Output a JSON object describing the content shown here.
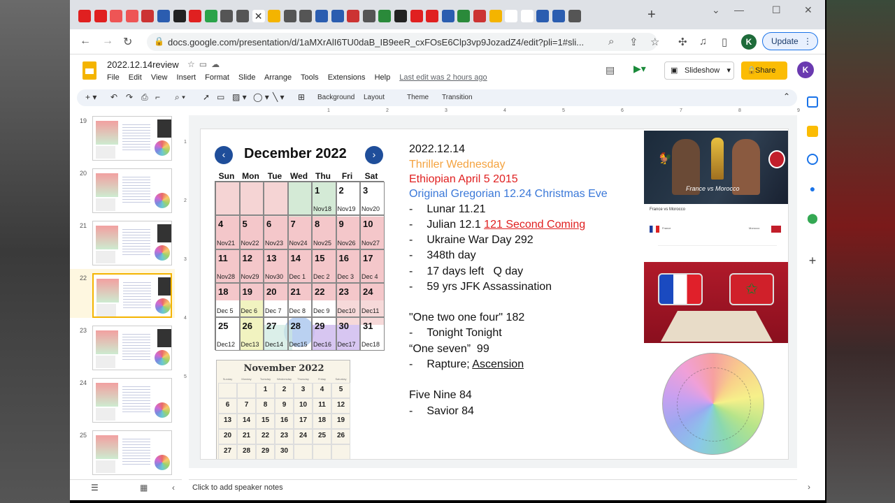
{
  "browser": {
    "url": "docs.google.com/presentation/d/1aMXrAlI6TU0daB_IB9eeR_cxFOsE6Clp3vp9JozadZ4/edit?pli=1#sli...",
    "update_label": "Update",
    "profile_initial": "K"
  },
  "doc": {
    "title": "2022.12.14review",
    "menus": [
      "File",
      "Edit",
      "View",
      "Insert",
      "Format",
      "Slide",
      "Arrange",
      "Tools",
      "Extensions",
      "Help"
    ],
    "last_edit": "Last edit was 2 hours ago",
    "slideshow_label": "Slideshow",
    "share_label": "Share",
    "user_initial": "K"
  },
  "toolbar": {
    "background": "Background",
    "layout": "Layout",
    "theme": "Theme",
    "transition": "Transition"
  },
  "ruler_marks": [
    "1",
    "2",
    "3",
    "4",
    "5",
    "6",
    "7",
    "8",
    "9"
  ],
  "vruler_marks": [
    "1",
    "2",
    "3",
    "4",
    "5"
  ],
  "thumbnails": [
    {
      "num": "19"
    },
    {
      "num": "20"
    },
    {
      "num": "21"
    },
    {
      "num": "22"
    },
    {
      "num": "23"
    },
    {
      "num": "24"
    },
    {
      "num": "25"
    }
  ],
  "calendar": {
    "title": "December 2022",
    "dow": [
      "Sun",
      "Mon",
      "Tue",
      "Wed",
      "Thu",
      "Fri",
      "Sat"
    ],
    "weeks": [
      [
        {
          "d": "",
          "s": ""
        },
        {
          "d": "",
          "s": ""
        },
        {
          "d": "",
          "s": ""
        },
        {
          "d": "",
          "s": ""
        },
        {
          "d": "1",
          "s": "Nov18"
        },
        {
          "d": "2",
          "s": "Nov19"
        },
        {
          "d": "3",
          "s": "Nov20"
        }
      ],
      [
        {
          "d": "4",
          "s": "Nov21"
        },
        {
          "d": "5",
          "s": "Nov22"
        },
        {
          "d": "6",
          "s": "Nov23"
        },
        {
          "d": "7",
          "s": "Nov24"
        },
        {
          "d": "8",
          "s": "Nov25"
        },
        {
          "d": "9",
          "s": "Nov26"
        },
        {
          "d": "10",
          "s": "Nov27"
        }
      ],
      [
        {
          "d": "11",
          "s": "Nov28"
        },
        {
          "d": "12",
          "s": "Nov29"
        },
        {
          "d": "13",
          "s": "Nov30"
        },
        {
          "d": "14",
          "s": "Dec 1"
        },
        {
          "d": "15",
          "s": "Dec 2"
        },
        {
          "d": "16",
          "s": "Dec 3"
        },
        {
          "d": "17",
          "s": "Dec 4"
        }
      ],
      [
        {
          "d": "18",
          "s": "Dec 5"
        },
        {
          "d": "19",
          "s": "Dec 6"
        },
        {
          "d": "20",
          "s": "Dec 7"
        },
        {
          "d": "21",
          "s": "Dec 8"
        },
        {
          "d": "22",
          "s": "Dec 9"
        },
        {
          "d": "23",
          "s": "Dec10"
        },
        {
          "d": "24",
          "s": "Dec11"
        }
      ],
      [
        {
          "d": "25",
          "s": "Dec12"
        },
        {
          "d": "26",
          "s": "Dec13"
        },
        {
          "d": "27",
          "s": "Dec14"
        },
        {
          "d": "28",
          "s": "Dec15"
        },
        {
          "d": "29",
          "s": "Dec16"
        },
        {
          "d": "30",
          "s": "Dec17"
        },
        {
          "d": "31",
          "s": "Dec18"
        }
      ]
    ]
  },
  "november": {
    "title": "November 2022",
    "dow": [
      "Sunday",
      "Monday",
      "Tuesday",
      "Wednesday",
      "Thursday",
      "Friday",
      "Saturday"
    ],
    "weeks": [
      [
        "",
        "",
        "1",
        "2",
        "3",
        "4",
        "5"
      ],
      [
        "6",
        "7",
        "8",
        "9",
        "10",
        "11",
        "12"
      ],
      [
        "13",
        "14",
        "15",
        "16",
        "17",
        "18",
        "19"
      ],
      [
        "20",
        "21",
        "22",
        "23",
        "24",
        "25",
        "26"
      ],
      [
        "27",
        "28",
        "29",
        "30",
        "",
        "",
        ""
      ]
    ]
  },
  "slide_text": {
    "date": "2022.12.14",
    "thriller": "Thriller Wednesday",
    "ethiopian": "Ethiopian April 5 2015",
    "gregorian": "Original Gregorian 12.24 Christmas Eve",
    "lunar": "Lunar 11.21",
    "julian_prefix": "Julian 12.1 ",
    "julian_link": "121 Second Coming",
    "ukraine": "Ukraine War Day 292",
    "day348": "348th day",
    "daysleft": "17 days left   Q day",
    "jfk": "59 yrs JFK Assassination",
    "one_two": "\"One two one four\" 182",
    "tonight": "Tonight Tonight",
    "one_seven": "“One seven”  99",
    "rapture_prefix": "Rapture; ",
    "ascension": "Ascension",
    "five_nine": "Five Nine 84",
    "savior": "Savior 84"
  },
  "colors": {
    "thriller": "#f4a340",
    "ethiopian": "#e02020",
    "gregorian": "#3a78d8",
    "share": "#fbbc04",
    "cal_arrow": "#1f4e9a"
  },
  "image_text": {
    "match_caption": "France vs Morocco",
    "card_title": "France vs Morocco",
    "team_a": "France",
    "team_b": "Morocco"
  },
  "notes_placeholder": "Click to add speaker notes"
}
